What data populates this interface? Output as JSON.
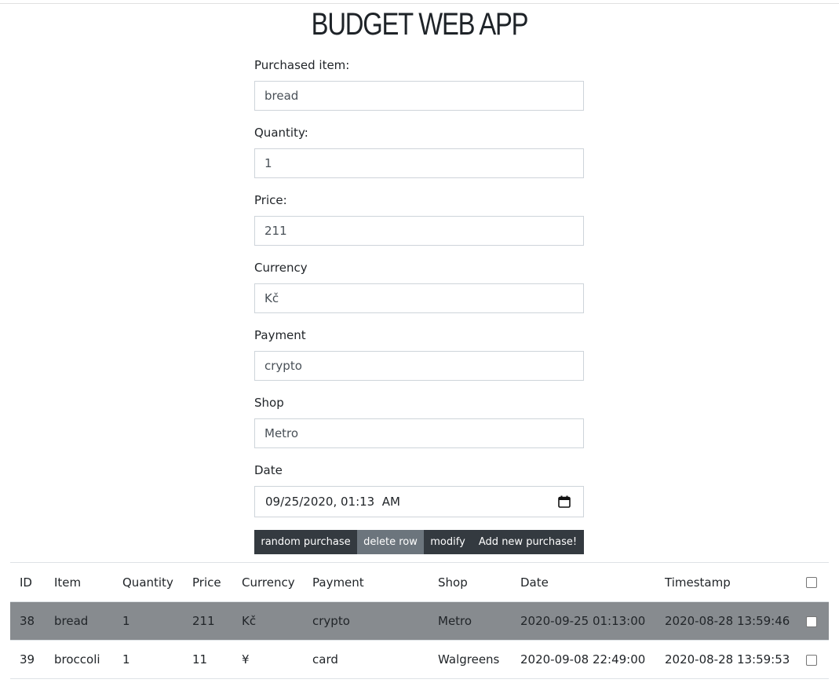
{
  "app": {
    "title": "BUDGET WEB APP"
  },
  "form": {
    "item_label": "Purchased item:",
    "item_value": "bread",
    "quantity_label": "Quantity:",
    "quantity_value": "1",
    "price_label": "Price:",
    "price_value": "211",
    "currency_label": "Currency",
    "currency_value": "Kč",
    "payment_label": "Payment",
    "payment_value": "crypto",
    "shop_label": "Shop",
    "shop_value": "Metro",
    "date_label": "Date",
    "date_value": "09/25/2020, 01:13  AM"
  },
  "buttons": {
    "random": "random purchase",
    "delete": "delete row",
    "modify": "modify",
    "add": "Add new purchase!"
  },
  "table": {
    "headers": [
      "ID",
      "Item",
      "Quantity",
      "Price",
      "Currency",
      "Payment",
      "Shop",
      "Date",
      "Timestamp"
    ],
    "rows": [
      {
        "selected": true,
        "cells": [
          "38",
          "bread",
          "1",
          "211",
          "Kč",
          "crypto",
          "Metro",
          "2020-09-25 01:13:00",
          "2020-08-28 13:59:46"
        ]
      },
      {
        "selected": false,
        "cells": [
          "39",
          "broccoli",
          "1",
          "11",
          "¥",
          "card",
          "Walgreens",
          "2020-09-08 22:49:00",
          "2020-08-28 13:59:53"
        ]
      }
    ]
  },
  "icons": {
    "date_picker": "calendar-icon"
  },
  "colors": {
    "button_dark": "#343a40",
    "button_active": "#6c757d",
    "selected_row": "#878b8f"
  }
}
